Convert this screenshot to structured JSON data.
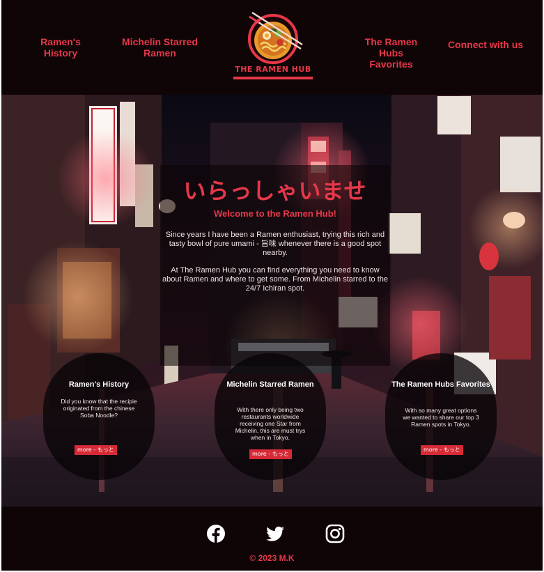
{
  "header": {
    "nav_left": [
      {
        "label": "Ramen's History"
      },
      {
        "label": "Michelin Starred Ramen"
      }
    ],
    "logo_text": "THE RAMEN HUB",
    "nav_right": [
      {
        "label": "The Ramen Hubs Favorites"
      },
      {
        "label": "Connect with us"
      }
    ]
  },
  "hero": {
    "title": "いらっしゃいませ",
    "subtitle": "Welcome to the Ramen Hub!",
    "paragraph_1": "Since years I have been a Ramen enthusiast, trying this rich and tasty bowl of pure umami - 旨味 whenever there is a good spot nearby.",
    "paragraph_2": "At The Ramen Hub you can find everything you need to know about Ramen and where to get some. From Michelin starred to the 24/7 Ichiran spot."
  },
  "cards": [
    {
      "title": "Ramen's History",
      "text": "Did you know that the recipie originated from the chinese Soba Noodle?",
      "button": "more - もっと"
    },
    {
      "title": "Michelin Starred Ramen",
      "text": "With there only being two restaurants worldwide receiving one Star from Michelin, this are must trys when in Tokyo.",
      "button": "more - もっと"
    },
    {
      "title": "The Ramen Hubs Favorites",
      "text": "With so many great options we wanted to share our top 3 Ramen spots in Tokyo.",
      "button": "more - もっと"
    }
  ],
  "footer": {
    "social_icons": [
      "facebook-icon",
      "twitter-icon",
      "instagram-icon"
    ],
    "copyright": "© 2023 M.K"
  },
  "colors": {
    "accent": "#e6384a",
    "background": "#100506",
    "button": "#d62a36"
  }
}
